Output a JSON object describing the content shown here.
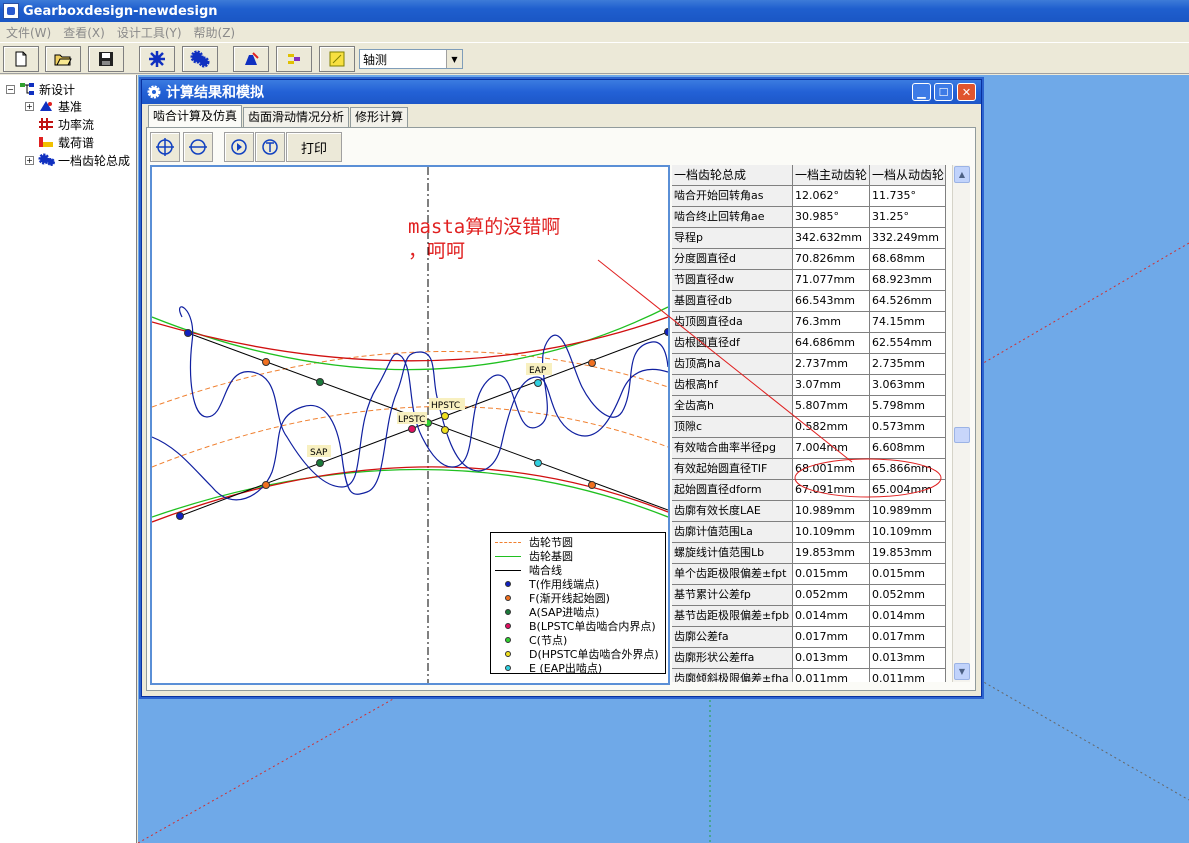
{
  "app": {
    "title": "Gearboxdesign-newdesign"
  },
  "menu": {
    "items": [
      "文件(W)",
      "查看(X)",
      "设计工具(Y)",
      "帮助(Z)"
    ]
  },
  "toolbar": {
    "view_select_value": "轴测"
  },
  "tree": {
    "root": "新设计",
    "items": [
      "基准",
      "功率流",
      "载荷谱",
      "一档齿轮总成"
    ]
  },
  "child_window": {
    "title": "计算结果和模拟",
    "tabs": [
      "啮合计算及仿真",
      "齿面滑动情况分析",
      "修形计算"
    ],
    "print_label": "打印"
  },
  "annotation": {
    "line1": "masta算的没错啊",
    "line2": "，呵呵"
  },
  "plot_labels": {
    "eap": "EAP",
    "hpstc": "HPSTC",
    "lpstc": "LPSTC",
    "sap": "SAP"
  },
  "legend": {
    "items": [
      "齿轮节圆",
      "齿轮基圆",
      "啮合线",
      "T(作用线端点)",
      "F(渐开线起始圆)",
      "A(SAP进啮点)",
      "B(LPSTC单齿啮合内界点)",
      "C(节点)",
      "D(HPSTC单齿啮合外界点)",
      "E (EAP出啮点)"
    ],
    "colors": {
      "pitch": "#f08030",
      "base": "#20c020",
      "action": "#000000",
      "T": "#1020c0",
      "F": "#f07020",
      "A": "#1a7a3a",
      "B": "#e01060",
      "C": "#30d030",
      "D": "#f0e020",
      "E": "#30d0e0"
    }
  },
  "table": {
    "headers": [
      "一档齿轮总成",
      "一档主动齿轮",
      "一档从动齿轮"
    ],
    "rows": [
      [
        "啮合开始回转角as",
        "12.062°",
        "11.735°"
      ],
      [
        "啮合终止回转角ae",
        "30.985°",
        "31.25°"
      ],
      [
        "导程p",
        "342.632mm",
        "332.249mm"
      ],
      [
        "分度圆直径d",
        "70.826mm",
        "68.68mm"
      ],
      [
        "节圆直径dw",
        "71.077mm",
        "68.923mm"
      ],
      [
        "基圆直径db",
        "66.543mm",
        "64.526mm"
      ],
      [
        "齿顶圆直径da",
        "76.3mm",
        "74.15mm"
      ],
      [
        "齿根圆直径df",
        "64.686mm",
        "62.554mm"
      ],
      [
        "齿顶高ha",
        "2.737mm",
        "2.735mm"
      ],
      [
        "齿根高hf",
        "3.07mm",
        "3.063mm"
      ],
      [
        "全齿高h",
        "5.807mm",
        "5.798mm"
      ],
      [
        "顶隙c",
        "0.582mm",
        "0.573mm"
      ],
      [
        "有效啮合曲率半径pg",
        "7.004mm",
        "6.608mm"
      ],
      [
        "有效起始圆直径TIF",
        "68.001mm",
        "65.866mm"
      ],
      [
        "起始圆直径dform",
        "67.091mm",
        "65.004mm"
      ],
      [
        "齿廓有效长度LAE",
        "10.989mm",
        "10.989mm"
      ],
      [
        "齿廓计值范围La",
        "10.109mm",
        "10.109mm"
      ],
      [
        "螺旋线计值范围Lb",
        "19.853mm",
        "19.853mm"
      ],
      [
        "单个齿距极限偏差±fpt",
        "0.015mm",
        "0.015mm"
      ],
      [
        "基节累计公差fp",
        "0.052mm",
        "0.052mm"
      ],
      [
        "基节齿距极限偏差±fpb",
        "0.014mm",
        "0.014mm"
      ],
      [
        "齿廓公差fa",
        "0.017mm",
        "0.017mm"
      ],
      [
        "齿廓形状公差ffa",
        "0.013mm",
        "0.013mm"
      ],
      [
        "齿廓倾斜极限偏差±fha",
        "0.011mm",
        "0.011mm"
      ]
    ]
  }
}
